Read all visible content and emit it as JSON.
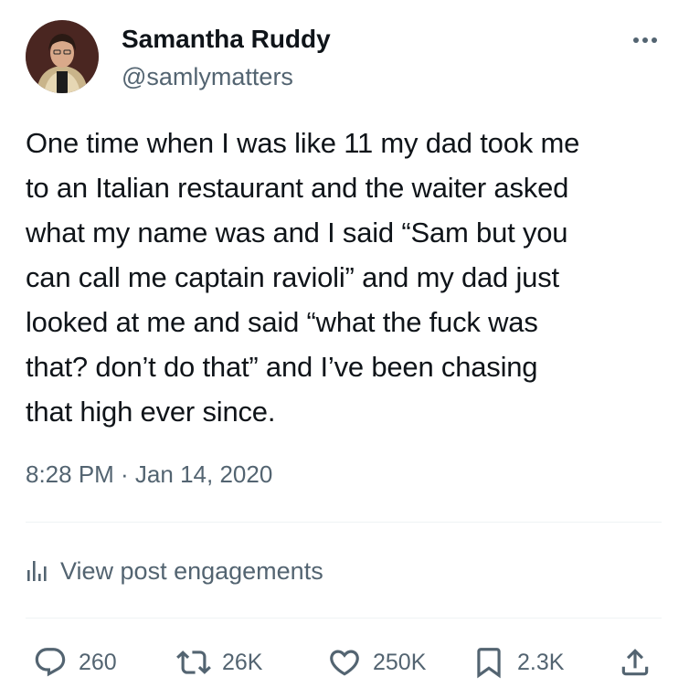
{
  "author": {
    "name": "Samantha Ruddy",
    "handle": "@samlymatters"
  },
  "tweet": {
    "text": "One time when I was like 11 my dad took me\nto an Italian restaurant and the waiter asked\nwhat my name was and I said “Sam but you\ncan call me captain ravioli” and my dad just\nlooked at me and said “what the fuck was\nthat? don’t do that” and I’ve been chasing\nthat high ever since.",
    "timestamp": "8:28 PM · Jan 14, 2020"
  },
  "engagements_link": {
    "label": "View post engagements",
    "icon": "bar-chart-icon"
  },
  "actions": {
    "replies": "260",
    "reposts": "26K",
    "likes": "250K",
    "bookmarks": "2.3K"
  },
  "icons": {
    "more": "more-horizontal-icon",
    "reply": "speech-bubble-icon",
    "repost": "repost-arrows-icon",
    "like": "heart-icon",
    "bookmark": "bookmark-icon",
    "share": "share-upload-icon"
  },
  "colors": {
    "text": "#0f1419",
    "secondary": "#536471",
    "divider": "#eff3f4"
  }
}
